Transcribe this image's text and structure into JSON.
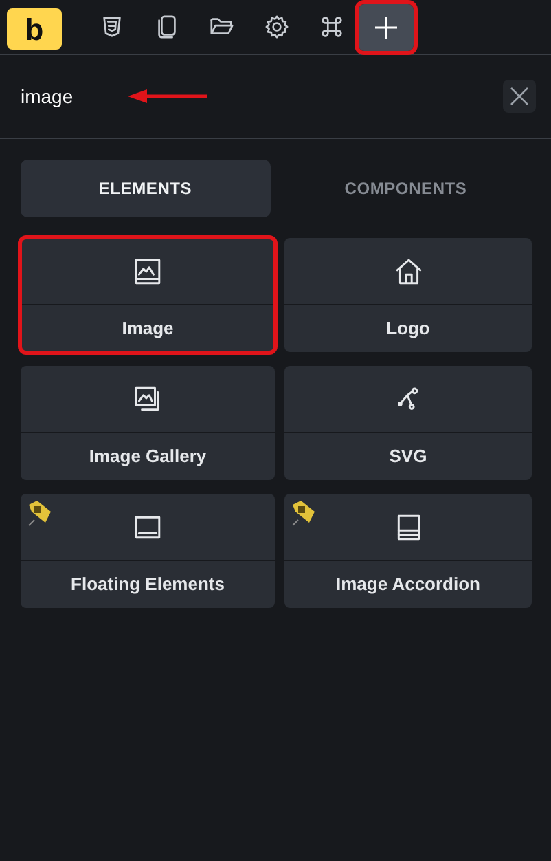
{
  "toolbar": {
    "logo": "b",
    "buttons": [
      {
        "kind": "css3",
        "selected": false,
        "highlighted": false
      },
      {
        "kind": "pages",
        "selected": false,
        "highlighted": false
      },
      {
        "kind": "folder",
        "selected": false,
        "highlighted": false
      },
      {
        "kind": "settings",
        "selected": false,
        "highlighted": false
      },
      {
        "kind": "command",
        "selected": false,
        "highlighted": false
      },
      {
        "kind": "add",
        "selected": true,
        "highlighted": true
      }
    ]
  },
  "search": {
    "value": "image",
    "arrow": true
  },
  "tabs": [
    {
      "label": "ELEMENTS",
      "selected": true
    },
    {
      "label": "COMPONENTS",
      "selected": false
    }
  ],
  "elements": [
    {
      "label": "Image",
      "kind": "image",
      "badge": false,
      "highlighted": true
    },
    {
      "label": "Logo",
      "kind": "home",
      "badge": false,
      "highlighted": false
    },
    {
      "label": "Image Gallery",
      "kind": "gallery",
      "badge": false,
      "highlighted": false
    },
    {
      "label": "SVG",
      "kind": "vector",
      "badge": false,
      "highlighted": false
    },
    {
      "label": "Floating Elements",
      "kind": "floating",
      "badge": true,
      "highlighted": false
    },
    {
      "label": "Image Accordion",
      "kind": "accordion",
      "badge": true,
      "highlighted": false
    }
  ]
}
